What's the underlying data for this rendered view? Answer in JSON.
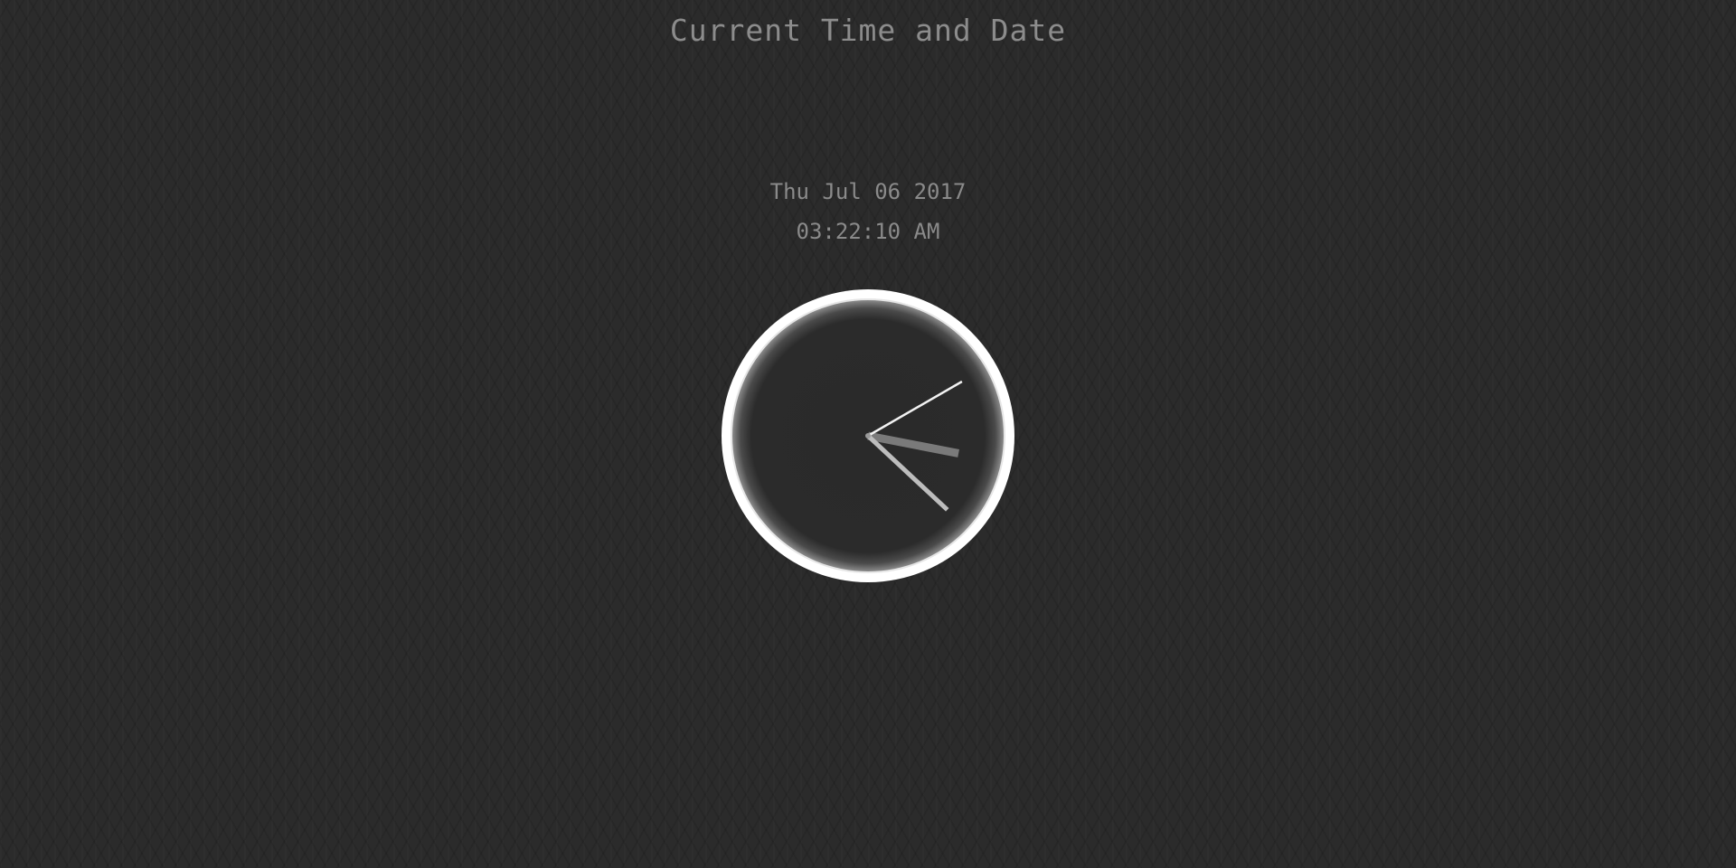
{
  "page": {
    "title": "Current Time and Date"
  },
  "datetime": {
    "date_text": "Thu Jul 06 2017",
    "time_text": "03:22:10 AM"
  },
  "clock": {
    "hours": 3,
    "minutes": 22,
    "seconds": 10,
    "colors": {
      "rim": "#ffffff",
      "face": "#2a2a2a",
      "hour_hand": "#7a7a7a",
      "minute_hand": "#bdbdbd",
      "second_hand": "#f2f2f2"
    }
  }
}
